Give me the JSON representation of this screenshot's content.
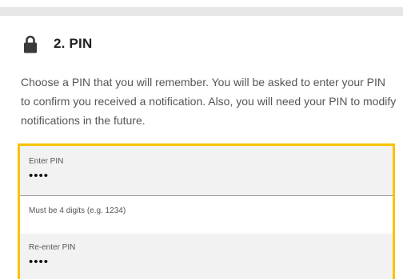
{
  "section": {
    "icon": "lock-icon",
    "title": "2. PIN",
    "description": "Choose a PIN that you will remember. You will be asked to enter your PIN to confirm you received a notification. Also, you will need your PIN to modify notifications in the future."
  },
  "form": {
    "highlight_color": "#f7c300",
    "pin": {
      "label": "Enter PIN",
      "value": "••••",
      "helper": "Must be 4 digits (e.g. 1234)"
    },
    "confirm_pin": {
      "label": "Re-enter PIN",
      "value": "••••"
    }
  }
}
